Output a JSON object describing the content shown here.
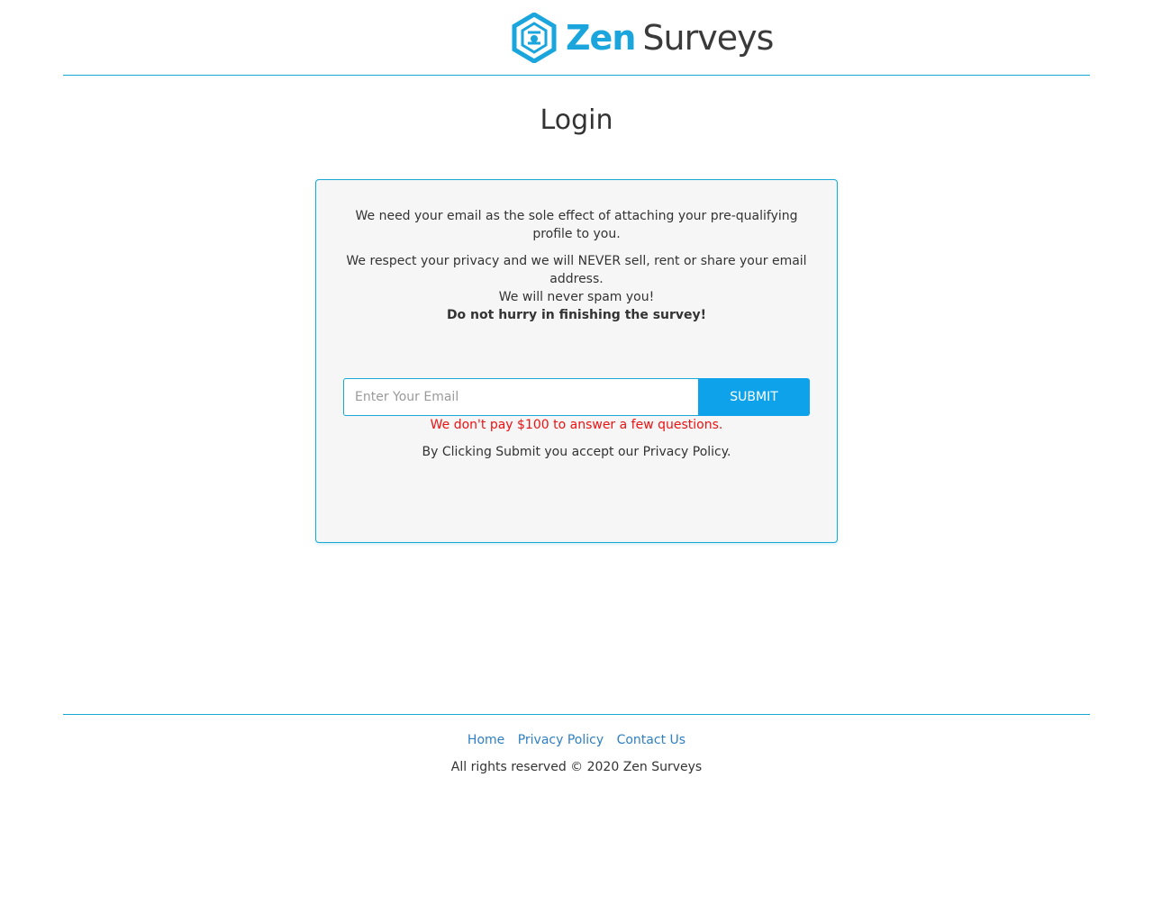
{
  "header": {
    "logo_zen": "Zen",
    "logo_surveys": "Surveys",
    "logo_icon": "zen-surveys-logo-icon"
  },
  "page_title": "Login",
  "card": {
    "intro_1": "We need your email as the sole effect of attaching your pre-qualifying profile to you.",
    "intro_2": "We respect your privacy and we will NEVER sell, rent or share your email address.",
    "intro_3": "We will never spam you!",
    "intro_4": "Do not hurry in finishing the survey!",
    "email_placeholder": "Enter Your Email",
    "email_value": "",
    "submit_label": "SUBMIT",
    "warning": "We don't pay $100 to answer a few questions.",
    "accept_text": "By Clicking Submit you accept our Privacy Policy."
  },
  "footer": {
    "links": [
      "Home",
      "Privacy Policy",
      "Contact Us"
    ],
    "copyright": "All rights reserved © 2020 Zen Surveys"
  },
  "colors": {
    "accent": "#17a9d1",
    "button": "#0da2ea",
    "warning": "#ee1111",
    "link": "#2f7fc1",
    "card_bg": "#f6f6f6"
  }
}
